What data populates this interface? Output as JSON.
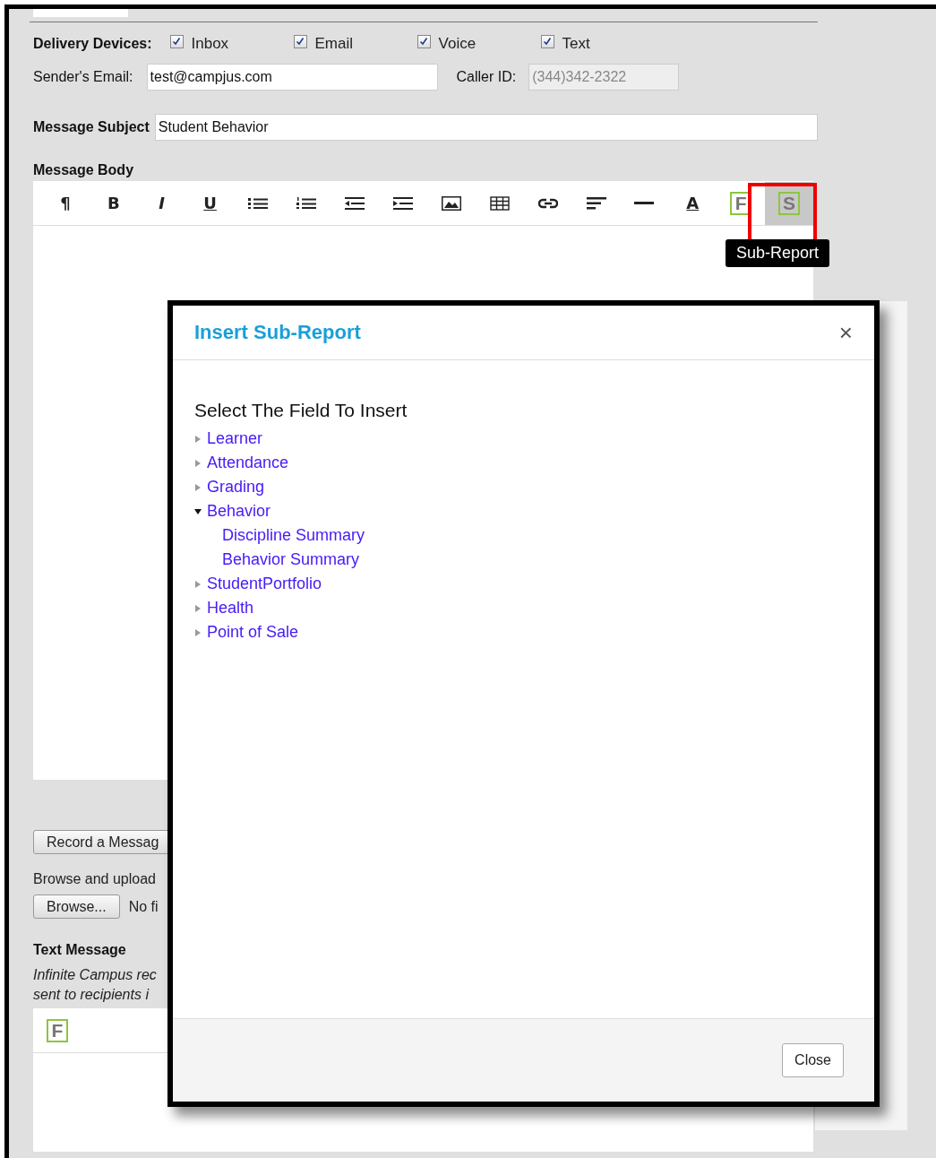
{
  "delivery": {
    "label": "Delivery Devices:",
    "devices": [
      {
        "label": "Inbox",
        "checked": true
      },
      {
        "label": "Email",
        "checked": true
      },
      {
        "label": "Voice",
        "checked": true
      },
      {
        "label": "Text",
        "checked": true
      }
    ]
  },
  "sender": {
    "label": "Sender's Email:",
    "value": "test@campjus.com"
  },
  "caller": {
    "label": "Caller ID:",
    "value": "(344)342-2322",
    "disabled": true
  },
  "subject": {
    "label": "Message Subject",
    "value": "Student Behavior"
  },
  "body": {
    "label": "Message Body",
    "tools": [
      {
        "kind": "glyph",
        "label": "¶",
        "selected": false
      },
      {
        "kind": "glyph",
        "label": "B",
        "selected": false
      },
      {
        "kind": "glyph",
        "label": "I",
        "selected": false
      },
      {
        "kind": "glyph",
        "label": "U",
        "selected": false
      },
      {
        "kind": "bullets",
        "selected": false
      },
      {
        "kind": "numbers",
        "selected": false
      },
      {
        "kind": "outdent",
        "selected": false
      },
      {
        "kind": "indent",
        "selected": false
      },
      {
        "kind": "image",
        "selected": false
      },
      {
        "kind": "table",
        "selected": false
      },
      {
        "kind": "link",
        "selected": false
      },
      {
        "kind": "align",
        "selected": false
      },
      {
        "kind": "rule",
        "selected": false
      },
      {
        "kind": "glyph",
        "label": "A",
        "selected": false
      },
      {
        "kind": "field",
        "label": "F",
        "selected": false
      },
      {
        "kind": "field",
        "label": "S",
        "selected": true
      }
    ],
    "tooltip": "Sub-Report"
  },
  "record_button": "Record a Messag",
  "upload": {
    "label": "Browse and upload",
    "button": "Browse...",
    "status": "No fi"
  },
  "text_message": {
    "title": "Text Message",
    "note_lines": [
      "Infinite Campus rec",
      "sent to recipients i"
    ],
    "tools": [
      {
        "kind": "field",
        "label": "F"
      }
    ]
  },
  "dialog": {
    "title": "Insert Sub-Report",
    "close_icon": "×",
    "prompt": "Select The Field To Insert",
    "tree": [
      {
        "label": "Learner",
        "expanded": false
      },
      {
        "label": "Attendance",
        "expanded": false
      },
      {
        "label": "Grading",
        "expanded": false
      },
      {
        "label": "Behavior",
        "expanded": true,
        "children": [
          {
            "label": "Discipline Summary"
          },
          {
            "label": "Behavior Summary"
          }
        ]
      },
      {
        "label": "StudentPortfolio",
        "expanded": false
      },
      {
        "label": "Health",
        "expanded": false
      },
      {
        "label": "Point of Sale",
        "expanded": false
      }
    ],
    "button": "Close"
  }
}
